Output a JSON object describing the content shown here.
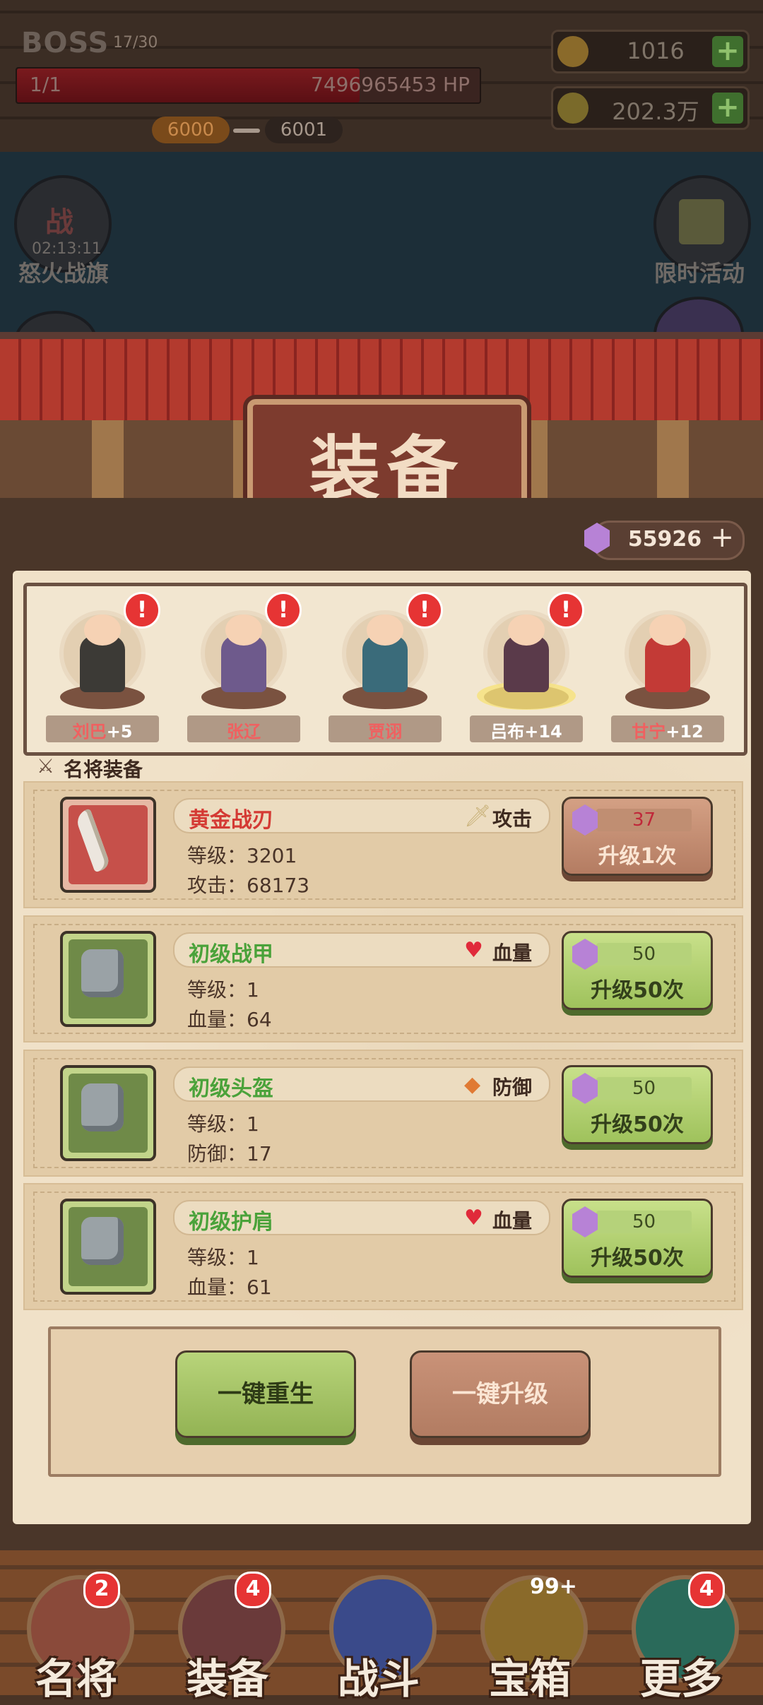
{
  "hud": {
    "boss_label": "BOSS",
    "boss_count": "17/30",
    "hp_left": "1/1",
    "hp_value": "7496965453 HP",
    "hp_fill_fraction": 0.74,
    "stage_from": "6000",
    "stage_to": "6001",
    "gold": "1016",
    "coins": "202.3万"
  },
  "scene": {
    "left_timer": "02:13:11",
    "left_button": "怒火战旗",
    "left_flag_char": "战",
    "right_button": "限时活动"
  },
  "title": "装备",
  "gems": "55926",
  "heroes": [
    {
      "name": "刘巴",
      "plus": "+5",
      "alert": "!",
      "body_color": "#3c3a36",
      "name_color": "#f06060"
    },
    {
      "name": "张辽",
      "plus": "",
      "alert": "!",
      "body_color": "#6e5a8c",
      "name_color": "#f06060"
    },
    {
      "name": "贾诩",
      "plus": "",
      "alert": "!",
      "body_color": "#3a6b7a",
      "name_color": "#f06060"
    },
    {
      "name": "吕布",
      "plus": "+14",
      "alert": "!",
      "body_color": "#5a3a4a",
      "name_color": "#ffffff"
    },
    {
      "name": "甘宁",
      "plus": "+12",
      "alert": "",
      "body_color": "#c33a36",
      "name_color": "#f06060"
    }
  ],
  "section_label": "名将装备",
  "equipment": [
    {
      "name": "黄金战刃",
      "name_color": "#d43a34",
      "type": "攻击",
      "type_icon": "sword-icon",
      "level_label": "等级：3201",
      "stat_label": "攻击：68173",
      "cost": "37",
      "button": "升级1次",
      "rarity": "red"
    },
    {
      "name": "初级战甲",
      "name_color": "#4aa23a",
      "type": "血量",
      "type_icon": "heart-icon",
      "level_label": "等级：1",
      "stat_label": "血量：64",
      "cost": "50",
      "button": "升级50次",
      "rarity": "green"
    },
    {
      "name": "初级头盔",
      "name_color": "#4aa23a",
      "type": "防御",
      "type_icon": "shield-icon",
      "level_label": "等级：1",
      "stat_label": "防御：17",
      "cost": "50",
      "button": "升级50次",
      "rarity": "green"
    },
    {
      "name": "初级护肩",
      "name_color": "#4aa23a",
      "type": "血量",
      "type_icon": "heart-icon",
      "level_label": "等级：1",
      "stat_label": "血量：61",
      "cost": "50",
      "button": "升级50次",
      "rarity": "green"
    }
  ],
  "actions": {
    "rebirth": "一键重生",
    "upgrade_all": "一键升级"
  },
  "nav": [
    {
      "label": "名将",
      "badge": "2"
    },
    {
      "label": "装备",
      "badge": "4"
    },
    {
      "label": "战斗",
      "badge": ""
    },
    {
      "label": "宝箱",
      "badge": "99+"
    },
    {
      "label": "更多",
      "badge": "4"
    }
  ]
}
